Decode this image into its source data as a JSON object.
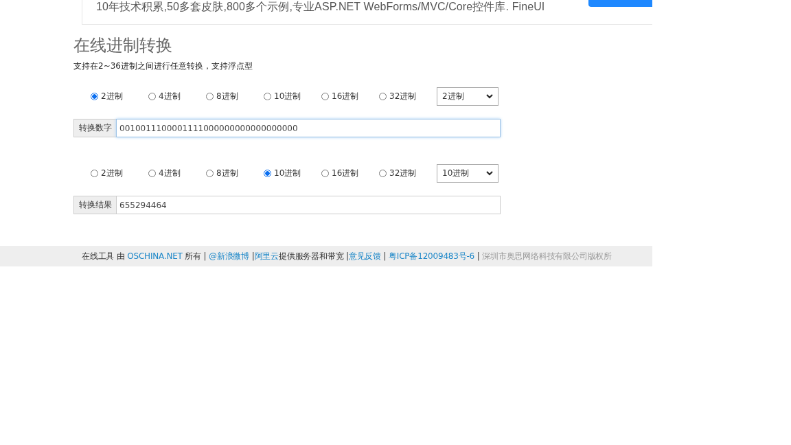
{
  "banner": {
    "text": "10年技术积累,50多套皮肤,800多个示例,专业ASP.NET WebForms/MVC/Core控件库. FineUI"
  },
  "title": "在线进制转换",
  "subtitle": "支持在2~36进制之间进行任意转换，支持浮点型",
  "converters": [
    {
      "radios": [
        {
          "label": "2进制",
          "selected": true
        },
        {
          "label": "4进制",
          "selected": false
        },
        {
          "label": "8进制",
          "selected": false
        },
        {
          "label": "10进制",
          "selected": false
        },
        {
          "label": "16进制",
          "selected": false
        },
        {
          "label": "32进制",
          "selected": false
        }
      ],
      "select": "2进制",
      "field_label": "转换数字",
      "value": "0010011100001111000000000000000000",
      "focused": true
    },
    {
      "radios": [
        {
          "label": "2进制",
          "selected": false
        },
        {
          "label": "4进制",
          "selected": false
        },
        {
          "label": "8进制",
          "selected": false
        },
        {
          "label": "10进制",
          "selected": true
        },
        {
          "label": "16进制",
          "selected": false
        },
        {
          "label": "32进制",
          "selected": false
        }
      ],
      "select": "10进制",
      "field_label": "转换结果",
      "value": "655294464",
      "focused": false
    }
  ],
  "footer": [
    {
      "kind": "text",
      "text": "在线工具 由 "
    },
    {
      "kind": "link",
      "text": "OSCHINA.NET"
    },
    {
      "kind": "text",
      "text": " 所有 | "
    },
    {
      "kind": "link",
      "text": "@新浪微博"
    },
    {
      "kind": "text",
      "text": " |"
    },
    {
      "kind": "link",
      "text": "阿里云"
    },
    {
      "kind": "text",
      "text": "提供服务器和带宽 |"
    },
    {
      "kind": "link",
      "text": "意见反馈"
    },
    {
      "kind": "text",
      "text": " | "
    },
    {
      "kind": "link",
      "text": "粤ICP备12009483号-6"
    },
    {
      "kind": "text",
      "text": " | "
    },
    {
      "kind": "muted",
      "text": "深圳市奥思网络科技有限公司版权所"
    }
  ]
}
